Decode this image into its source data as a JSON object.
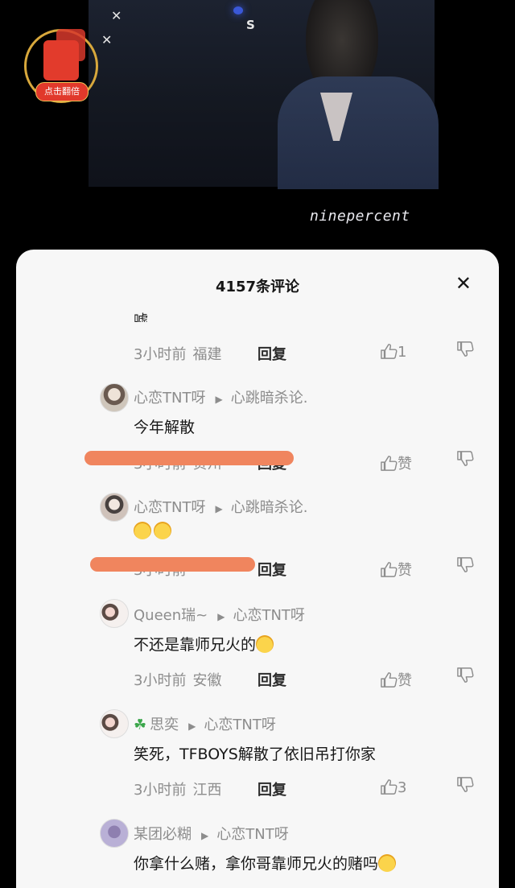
{
  "video": {
    "stage_sign": "S",
    "watermark": "ninepercent"
  },
  "redpack": {
    "label": "点击翻倍"
  },
  "sheet": {
    "title": "4157条评论",
    "partial_text": "嘘"
  },
  "reply_label": "回复",
  "comments": [
    {
      "meta_time": "3小时前",
      "meta_loc": "福建",
      "likes": "1"
    },
    {
      "user": "心恋TNT呀",
      "reply_to": "心跳暗杀论.",
      "text": "今年解散",
      "meta_time": "3小时前",
      "meta_loc": "贵州",
      "likes": "赞"
    },
    {
      "user": "心恋TNT呀",
      "reply_to": "心跳暗杀论.",
      "text": "",
      "meta_time": "3小时前",
      "meta_loc": "",
      "likes": "赞"
    },
    {
      "user": "Queen瑞~",
      "reply_to": "心恋TNT呀",
      "text": "不还是靠师兄火的",
      "meta_time": "3小时前",
      "meta_loc": "安徽",
      "likes": "赞"
    },
    {
      "user": "思奕",
      "reply_to": "心恋TNT呀",
      "text": "笑死，TFBOYS解散了依旧吊打你家",
      "meta_time": "3小时前",
      "meta_loc": "江西",
      "likes": "3"
    },
    {
      "user": "某团必糊",
      "reply_to": "心恋TNT呀",
      "text": "你拿什么赌，拿你哥靠师兄火的赌吗"
    }
  ]
}
